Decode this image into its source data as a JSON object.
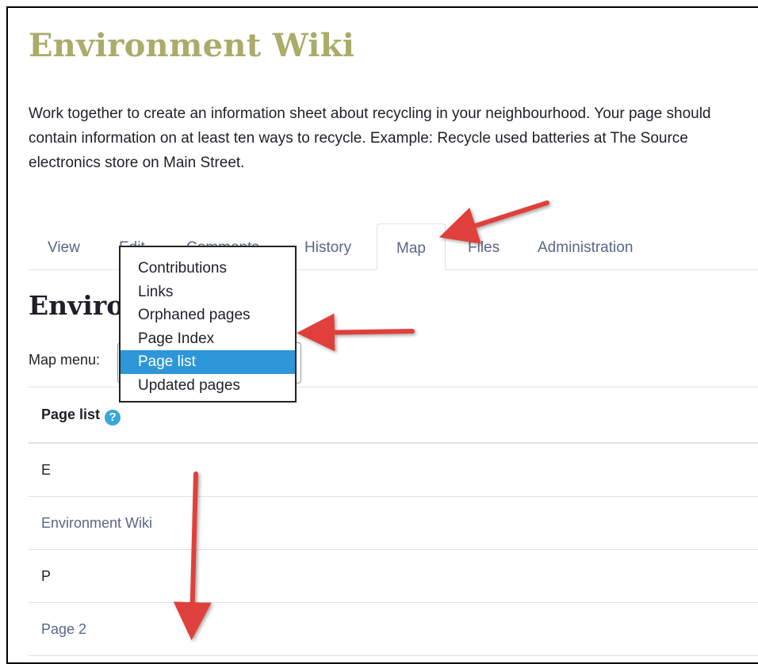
{
  "title": "Environment Wiki",
  "description": "Work together to create an information sheet about recycling in your neighbourhood. Your page should contain information on at least ten ways to recycle. Example: Recycle used batteries at The Source electronics store on Main Street.",
  "tabs": [
    {
      "label": "View"
    },
    {
      "label": "Edit"
    },
    {
      "label": "Comments"
    },
    {
      "label": "History"
    },
    {
      "label": "Map",
      "active": true
    },
    {
      "label": "Files"
    },
    {
      "label": "Administration"
    }
  ],
  "page_heading": "Environment Wiki",
  "map_menu": {
    "label": "Map menu:",
    "selected": "Page list",
    "options": [
      "Contributions",
      "Links",
      "Orphaned pages",
      "Page Index",
      "Page list",
      "Updated pages"
    ]
  },
  "table": {
    "header": "Page list",
    "help_icon": "help-icon",
    "rows": [
      {
        "text": "E",
        "type": "letter"
      },
      {
        "text": "Environment Wiki",
        "type": "link"
      },
      {
        "text": "P",
        "type": "letter"
      },
      {
        "text": "Page 2",
        "type": "link"
      }
    ]
  },
  "colors": {
    "title": "#a9ac6a",
    "link": "#5b6688",
    "selected": "#2d96d8",
    "arrow": "#e0403a"
  }
}
